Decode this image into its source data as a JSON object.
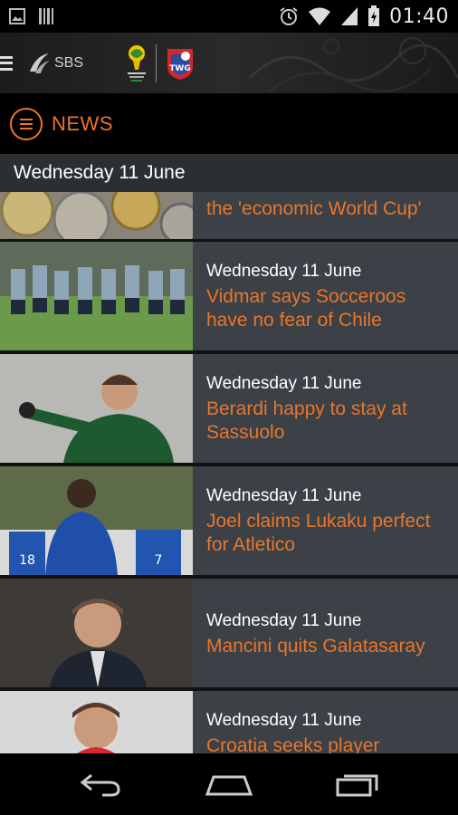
{
  "status_bar": {
    "time": "01:40",
    "icons": [
      "image-notification-icon",
      "barcode-notification-icon",
      "alarm-icon",
      "wifi-icon",
      "signal-icon",
      "battery-charging-icon"
    ]
  },
  "app_bar": {
    "brand": "SBS",
    "logo_icons": [
      "sbs-logo-icon",
      "fifa-world-cup-brazil-logo",
      "twg-logo"
    ]
  },
  "section": {
    "title": "NEWS",
    "icon": "menu-list-icon",
    "accent_color": "#e8762b"
  },
  "date_header": "Wednesday 11 June",
  "articles": [
    {
      "date": "",
      "title": "the 'economic World Cup'",
      "thumb": "coins"
    },
    {
      "date": "Wednesday 11 June",
      "title": "Vidmar says Socceroos have no fear of Chile",
      "thumb": "team-training"
    },
    {
      "date": "Wednesday 11 June",
      "title": "Berardi happy to stay at Sassuolo",
      "thumb": "player-green"
    },
    {
      "date": "Wednesday 11 June",
      "title": "Joel claims Lukaku perfect for Atletico",
      "thumb": "player-blue"
    },
    {
      "date": "Wednesday 11 June",
      "title": "Mancini quits Galatasaray",
      "thumb": "coach-portrait"
    },
    {
      "date": "Wednesday 11 June",
      "title": "Croatia seeks player",
      "thumb": "player-red"
    }
  ],
  "nav_bar": {
    "buttons": [
      "back-icon",
      "home-icon",
      "recent-apps-icon"
    ]
  }
}
